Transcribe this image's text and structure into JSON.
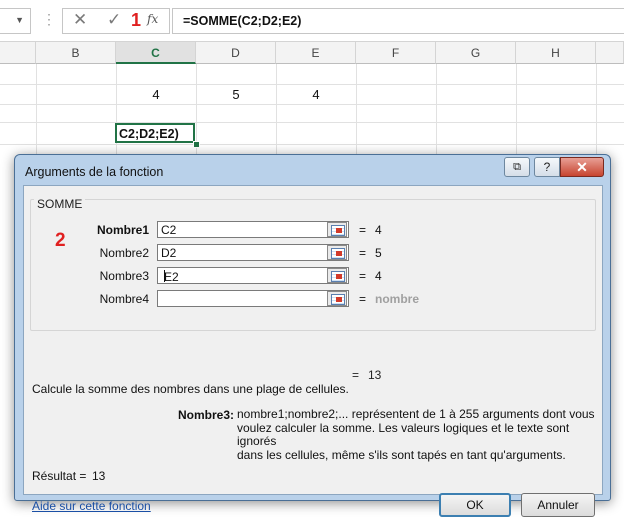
{
  "formula_bar": {
    "formula": "=SOMME(C2;D2;E2)",
    "cancel_icon": "✕",
    "enter_icon": "✓",
    "fx_label": "fx",
    "annotation": "1"
  },
  "columns": [
    "B",
    "C",
    "D",
    "E",
    "F",
    "G",
    "H"
  ],
  "selected_column": "C",
  "cells": {
    "c2": "4",
    "d2": "5",
    "e2": "4",
    "editing": "C2;D2;E2)"
  },
  "dialog": {
    "title": "Arguments de la fonction",
    "buttons": {
      "restore": "⧉",
      "help": "?",
      "close": "✕"
    },
    "function_name": "SOMME",
    "annotation": "2",
    "arguments": [
      {
        "label": "Nombre1",
        "value": "C2",
        "result": "4",
        "bold": true
      },
      {
        "label": "Nombre2",
        "value": "D2",
        "result": "5",
        "bold": false
      },
      {
        "label": "Nombre3",
        "value": "E2",
        "result": "4",
        "bold": false
      },
      {
        "label": "Nombre4",
        "value": "",
        "result": "nombre",
        "bold": false
      }
    ],
    "equals": "=",
    "total": "13",
    "description": "Calcule la somme des nombres dans une plage de cellules.",
    "arg_help_label": "Nombre3:",
    "arg_help_lines": [
      "nombre1;nombre2;... représentent de 1 à 255 arguments dont vous",
      "voulez calculer la somme. Les valeurs logiques et le texte sont ignorés",
      "dans les cellules, même s'ils sont tapés en tant qu'arguments."
    ],
    "result_label": "Résultat =",
    "result_value": "13",
    "help_link": "Aide sur cette fonction",
    "ok_label": "OK",
    "cancel_label": "Annuler"
  }
}
